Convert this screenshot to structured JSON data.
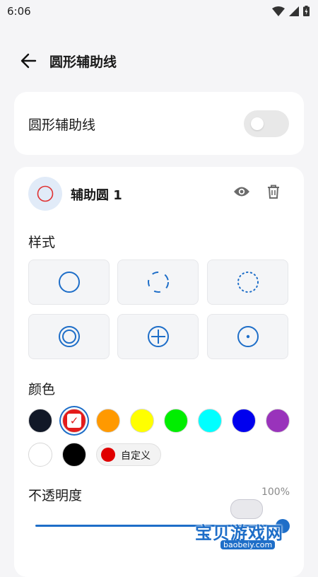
{
  "status_bar": {
    "time": "6:06"
  },
  "header": {
    "title": "圆形辅助线"
  },
  "main_toggle": {
    "label": "圆形辅助线",
    "enabled": false
  },
  "circle_card": {
    "name": "辅助圆 1",
    "style_label": "样式",
    "styles": [
      {
        "icon": "solid-circle-icon",
        "selected": true
      },
      {
        "icon": "dashed-circle-icon",
        "selected": false
      },
      {
        "icon": "dotted-circle-icon",
        "selected": false
      },
      {
        "icon": "double-circle-icon",
        "selected": false
      },
      {
        "icon": "crosshair-circle-icon",
        "selected": false
      },
      {
        "icon": "center-dot-circle-icon",
        "selected": false
      }
    ],
    "color_label": "颜色",
    "colors": [
      "#111827",
      "#e41b1b",
      "#ff9900",
      "#ffff00",
      "#00ee00",
      "#00ffff",
      "#0000ee",
      "#9933bb",
      "#ffffff",
      "#000000"
    ],
    "selected_color_index": 1,
    "custom_color": {
      "label": "自定义",
      "color": "#e00000"
    },
    "opacity_label": "不透明度",
    "opacity_value": "100%",
    "opacity_fraction": 1.0
  },
  "watermark": {
    "text": "宝贝游戏网",
    "url": "baobeiy.com"
  },
  "accent_color": "#1e6ec8"
}
